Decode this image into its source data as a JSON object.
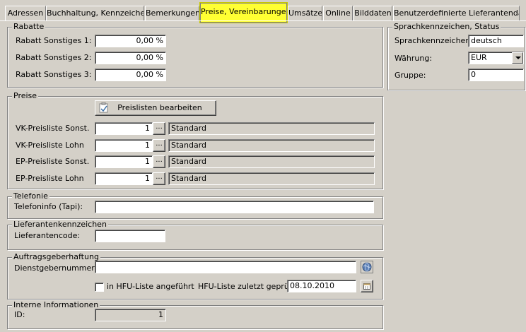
{
  "tabs": [
    {
      "label": "Adressen"
    },
    {
      "label": "Buchhaltung, Kennzeichen"
    },
    {
      "label": "Bemerkungen"
    },
    {
      "label": "Preise, Vereinbarungen"
    },
    {
      "label": "Umsätze"
    },
    {
      "label": "Online"
    },
    {
      "label": "Bilddaten"
    },
    {
      "label": "Benutzerdefinierte Lieferantendaten"
    }
  ],
  "rabatte": {
    "title": "Rabatte",
    "rows": [
      {
        "label": "Rabatt Sonstiges 1:",
        "value": "0,00 %"
      },
      {
        "label": "Rabatt Sonstiges 2:",
        "value": "0,00 %"
      },
      {
        "label": "Rabatt Sonstiges 3:",
        "value": "0,00 %"
      }
    ]
  },
  "sprache": {
    "title": "Sprachkennzeichen, Status",
    "sprach_label": "Sprachkennzeichen:",
    "sprach_value": "deutsch",
    "waehrung_label": "Währung:",
    "waehrung_value": "EUR",
    "gruppe_label": "Gruppe:",
    "gruppe_value": "0"
  },
  "preise": {
    "title": "Preise",
    "button_label": "Preislisten bearbeiten",
    "browse_label": "...",
    "rows": [
      {
        "label": "VK-Preisliste Sonst.",
        "value": "1",
        "name": "Standard"
      },
      {
        "label": "VK-Preisliste Lohn",
        "value": "1",
        "name": "Standard"
      },
      {
        "label": "EP-Preisliste Sonst.",
        "value": "1",
        "name": "Standard"
      },
      {
        "label": "EP-Preisliste Lohn",
        "value": "1",
        "name": "Standard"
      }
    ]
  },
  "telefonie": {
    "title": "Telefonie",
    "label": "Telefoninfo (Tapi):",
    "value": ""
  },
  "lieferantenkennzeichen": {
    "title": "Lieferantenkennzeichen",
    "label": "Lieferantencode:",
    "value": ""
  },
  "auftrag": {
    "title": "Auftragsgeberhaftung",
    "dienst_label": "Dienstgebernummer:",
    "dienst_value": "",
    "checkbox_label": "in HFU-Liste angeführt",
    "checkbox_checked": false,
    "geprueft_label": "HFU-Liste zuletzt geprüft:",
    "geprueft_value": "08.10.2010"
  },
  "intern": {
    "title": "Interne Informationen",
    "id_label": "ID:",
    "id_value": "1"
  }
}
